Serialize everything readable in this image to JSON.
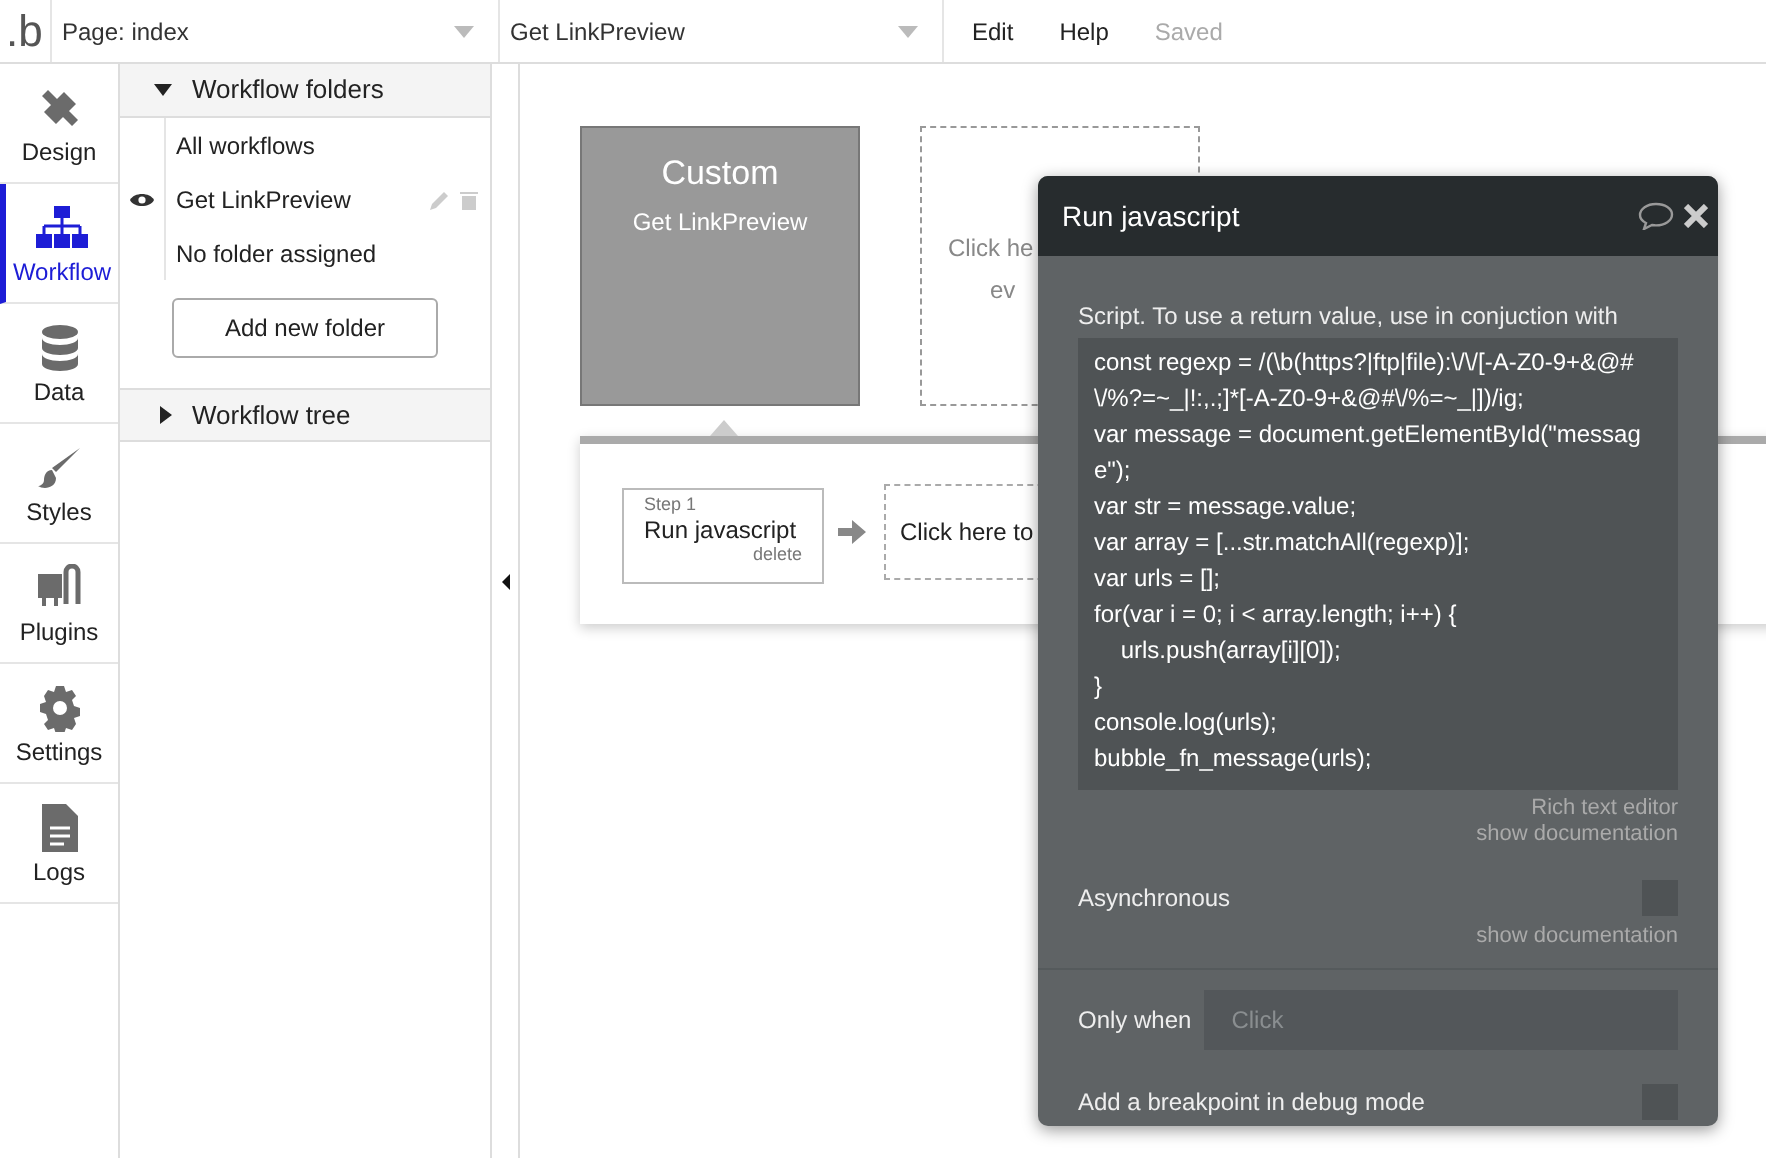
{
  "topbar": {
    "logo": ".b",
    "page_select": "Page: index",
    "workflow_select": "Get LinkPreview",
    "menu": [
      "Edit",
      "Help"
    ],
    "status": "Saved"
  },
  "rail": [
    {
      "label": "Design",
      "selected": false
    },
    {
      "label": "Workflow",
      "selected": true
    },
    {
      "label": "Data",
      "selected": false
    },
    {
      "label": "Styles",
      "selected": false
    },
    {
      "label": "Plugins",
      "selected": false
    },
    {
      "label": "Settings",
      "selected": false
    },
    {
      "label": "Logs",
      "selected": false
    }
  ],
  "folders": {
    "title": "Workflow folders",
    "expanded": true,
    "items": [
      {
        "label": "All workflows",
        "visible": false
      },
      {
        "label": "Get LinkPreview",
        "visible": true
      },
      {
        "label": "No folder assigned",
        "visible": false
      }
    ],
    "add_button": "Add new folder"
  },
  "tree": {
    "title": "Workflow tree",
    "expanded": false
  },
  "canvas": {
    "event": {
      "title": "Custom",
      "name": "Get LinkPreview"
    },
    "add_event": [
      "Click he",
      "ev"
    ],
    "step": {
      "number": "Step 1",
      "name": "Run javascript",
      "delete": "delete"
    },
    "add_action": "Click here to"
  },
  "popup": {
    "title": "Run javascript",
    "script_label": "Script. To use a return value, use in conjuction with",
    "script_lines": [
      "const regexp = /(\\b(https?|ftp|file):\\/\\/[-A-Z0-9+&@#\\/%?=~_|!:,.;]*[-A-Z0-9+&@#\\/%=~_|])/ig;",
      "var message = document.getElementById(\"message\");",
      "var str = message.value;",
      "var array = [...str.matchAll(regexp)];",
      "var urls = [];",
      "for(var i = 0; i < array.length; i++) {",
      "    urls.push(array[i][0]);",
      "}",
      "console.log(urls);",
      "bubble_fn_message(urls);"
    ],
    "rich_text_link": "Rich text editor",
    "doc_link": "show documentation",
    "asynchronous": {
      "label": "Asynchronous",
      "checked": false,
      "doc_link": "show documentation"
    },
    "only_when": {
      "label": "Only when",
      "placeholder": "Click"
    },
    "breakpoint": {
      "label": "Add a breakpoint in debug mode",
      "checked": false
    }
  }
}
